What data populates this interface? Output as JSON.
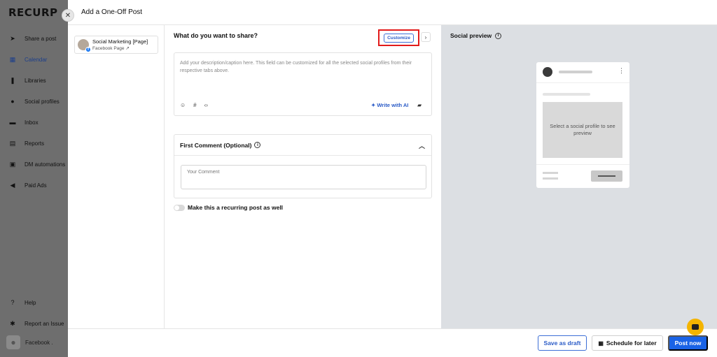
{
  "brand": "RECURP",
  "sidebar": {
    "items": [
      {
        "label": "Share a post",
        "icon": "paper-plane-icon",
        "glyph": "➤"
      },
      {
        "label": "Calendar",
        "icon": "calendar-icon",
        "glyph": "▦"
      },
      {
        "label": "Libraries",
        "icon": "library-icon",
        "glyph": "❚"
      },
      {
        "label": "Social profiles",
        "icon": "user-circle-icon",
        "glyph": "●"
      },
      {
        "label": "Inbox",
        "icon": "inbox-icon",
        "glyph": "▬"
      },
      {
        "label": "Reports",
        "icon": "report-icon",
        "glyph": "▤"
      },
      {
        "label": "DM automations",
        "icon": "chat-icon",
        "glyph": "▣"
      },
      {
        "label": "Paid Ads",
        "icon": "megaphone-icon",
        "glyph": "◀"
      }
    ],
    "bottom": [
      {
        "label": "Help",
        "icon": "help-icon",
        "glyph": "?"
      },
      {
        "label": "Report an Issue",
        "icon": "bug-icon",
        "glyph": "✱"
      }
    ],
    "account": "Facebook ."
  },
  "modal": {
    "title": "Add a One-Off Post",
    "close_glyph": "✕",
    "profile": {
      "name": "Social Marketing [Page]",
      "type": "Facebook Page ↗"
    },
    "compose": {
      "title": "What do you want to share?",
      "customize_label": "Customize",
      "chevron": "›",
      "placeholder": "Add your description/caption here. This field can be customized for all the selected social profiles from their respective tabs above.",
      "tools": [
        "☺",
        "#",
        "‹›"
      ],
      "write_ai": "✦ Write with AI",
      "ai_extra": "▰"
    },
    "first_comment": {
      "title": "First Comment (Optional)",
      "info": "i",
      "caret": "︿",
      "placeholder": "Your Comment"
    },
    "recurring_label": "Make this a recurring post as well",
    "preview": {
      "title": "Social preview",
      "info": "i",
      "dots": "⋮",
      "message": "Select a social profile to see preview"
    },
    "footer": {
      "draft": "Save as draft",
      "schedule": "Schedule for later",
      "schedule_icon": "▦",
      "post": "Post now"
    }
  },
  "colors": {
    "accent": "#1a63e6",
    "highlight": "#e21b1b",
    "chat": "#f4b400"
  }
}
